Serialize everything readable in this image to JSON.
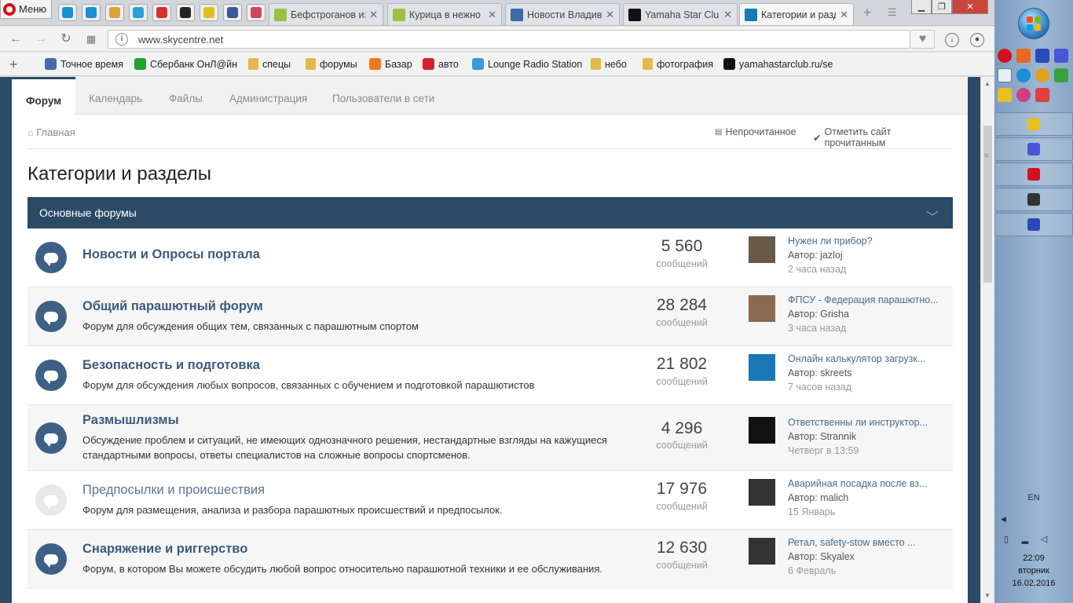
{
  "browser": {
    "menu_label": "Меню",
    "speed_dials": [
      {
        "icon": "skype-icon",
        "color": "#1a8fd6"
      },
      {
        "icon": "skype-icon",
        "color": "#1a8fd6"
      },
      {
        "icon": "weather-icon",
        "color": "#d9a440"
      },
      {
        "icon": "telegram-icon",
        "color": "#2aa0d8"
      },
      {
        "icon": "map-pin-icon",
        "color": "#d6312a"
      },
      {
        "icon": "runner-icon",
        "color": "#222222"
      },
      {
        "icon": "ad-icon",
        "color": "#e0c020"
      },
      {
        "icon": "facebook-icon",
        "color": "#3b5998"
      },
      {
        "icon": "pdf-icon",
        "color": "#d0465a"
      }
    ],
    "tabs": [
      {
        "label": "Бефстроганов из",
        "icon": "star-icon",
        "color": "#9ac140",
        "active": false
      },
      {
        "label": "Курица в нежно",
        "icon": "star-icon",
        "color": "#9ac140",
        "active": false
      },
      {
        "label": "Новости Владиво",
        "icon": "news-icon",
        "color": "#3a6aa8",
        "active": false
      },
      {
        "label": "Yamaha Star Club",
        "icon": "star-club-icon",
        "color": "#111111",
        "active": false
      },
      {
        "label": "Категории и разд",
        "icon": "sc-icon",
        "color": "#1b78b8",
        "active": true
      }
    ],
    "url": "www.skycentre.net",
    "bookmarks": [
      {
        "label": "Точное время",
        "icon": "clock-icon",
        "color": "#4a6ab0",
        "type": "icon"
      },
      {
        "label": "Сбербанк ОнЛ@йн",
        "icon": "sberbank-icon",
        "color": "#21a038",
        "type": "icon"
      },
      {
        "label": "спецы",
        "type": "folder"
      },
      {
        "label": "форумы",
        "type": "folder"
      },
      {
        "label": "Базар",
        "icon": "f-icon",
        "color": "#f07820",
        "type": "icon"
      },
      {
        "label": "авто",
        "icon": "auto-icon",
        "color": "#d42030",
        "type": "icon"
      },
      {
        "label": "Lounge Radio Station",
        "icon": "radio-icon",
        "color": "#3a9ad8",
        "type": "icon"
      },
      {
        "label": "небо",
        "type": "folder"
      },
      {
        "label": "фотография",
        "type": "folder"
      },
      {
        "label": "yamahastarclub.ru/se",
        "icon": "star-club-icon",
        "color": "#111111",
        "type": "icon"
      }
    ]
  },
  "site": {
    "nav": [
      "Форум",
      "Календарь",
      "Файлы",
      "Администрация",
      "Пользователи в сети"
    ],
    "breadcrumb": "Главная",
    "unread_label": "Непрочитанное",
    "mark_read_label": "Отметить сайт прочитанным",
    "page_title": "Категории и разделы",
    "category_title": "Основные форумы",
    "forums": [
      {
        "title": "Новости и Опросы портала",
        "description": "",
        "count": "5 560",
        "count_label": "сообщений",
        "unread": true,
        "last_post": {
          "title": "Нужен ли прибор?",
          "author": "Автор: jazloj",
          "time": "2 часа назад",
          "avatar_color": "#6a5a48"
        }
      },
      {
        "title": "Общий парашютный форум",
        "description": "Форум для обсуждения общих тем, связанных с парашютным спортом",
        "count": "28 284",
        "count_label": "сообщений",
        "unread": true,
        "last_post": {
          "title": "ФПСУ - Федерация парашютно...",
          "author": "Автор: Grisha",
          "time": "3 часа назад",
          "avatar_color": "#8a6a50"
        }
      },
      {
        "title": "Безопасность и подготовка",
        "description": "Форум для обсуждения любых вопросов, связанных с обучением и подготовкой парашютистов",
        "count": "21 802",
        "count_label": "сообщений",
        "unread": true,
        "last_post": {
          "title": "Онлайн калькулятор загрузк...",
          "author": "Автор: skreets",
          "time": "7 часов назад",
          "avatar_color": "#1b78b8"
        }
      },
      {
        "title": "Размышлизмы",
        "description": "Обсуждение проблем и ситуаций, не имеющих однозначного решения, нестандартные взгляды на кажущиеся стандартными вопросы, ответы специалистов на сложные вопросы спортсменов.",
        "count": "4 296",
        "count_label": "сообщений",
        "unread": true,
        "last_post": {
          "title": "Ответственны ли инструктор...",
          "author": "Автор: Strannik",
          "time": "Четверг в 13:59",
          "avatar_color": "#111111"
        }
      },
      {
        "title": "Предпосылки и происшествия",
        "description": "Форум для размещения, анализа и разбора парашютных происшествий и предпосылок.",
        "count": "17 976",
        "count_label": "сообщений",
        "unread": false,
        "last_post": {
          "title": "Аварийная посадка после вз...",
          "author": "Автор: malich",
          "time": "15 Январь",
          "avatar_color": "#333333"
        }
      },
      {
        "title": "Снаряжение и риггерство",
        "description": "Форум, в котором Вы можете обсудить любой вопрос относительно парашютной техники и ее обслуживания.",
        "count": "12 630",
        "count_label": "сообщений",
        "unread": true,
        "last_post": {
          "title": "Ретал, safety-stow вместо ...",
          "author": "Автор: Skyalex",
          "time": "6 Февраль",
          "avatar_color": "#333333"
        }
      }
    ]
  },
  "taskbar": {
    "language": "EN",
    "time": "22:09",
    "weekday": "вторник",
    "date": "16.02.2016",
    "pinned": [
      {
        "icon": "chrome-icon",
        "color": "#e8c020"
      },
      {
        "icon": "dropbox-like-icon",
        "color": "#4a56d8"
      },
      {
        "icon": "opera-icon",
        "color": "#d3111c"
      },
      {
        "icon": "tanks-icon",
        "color": "#333333"
      },
      {
        "icon": "save-icon",
        "color": "#2a4ab8"
      }
    ]
  }
}
